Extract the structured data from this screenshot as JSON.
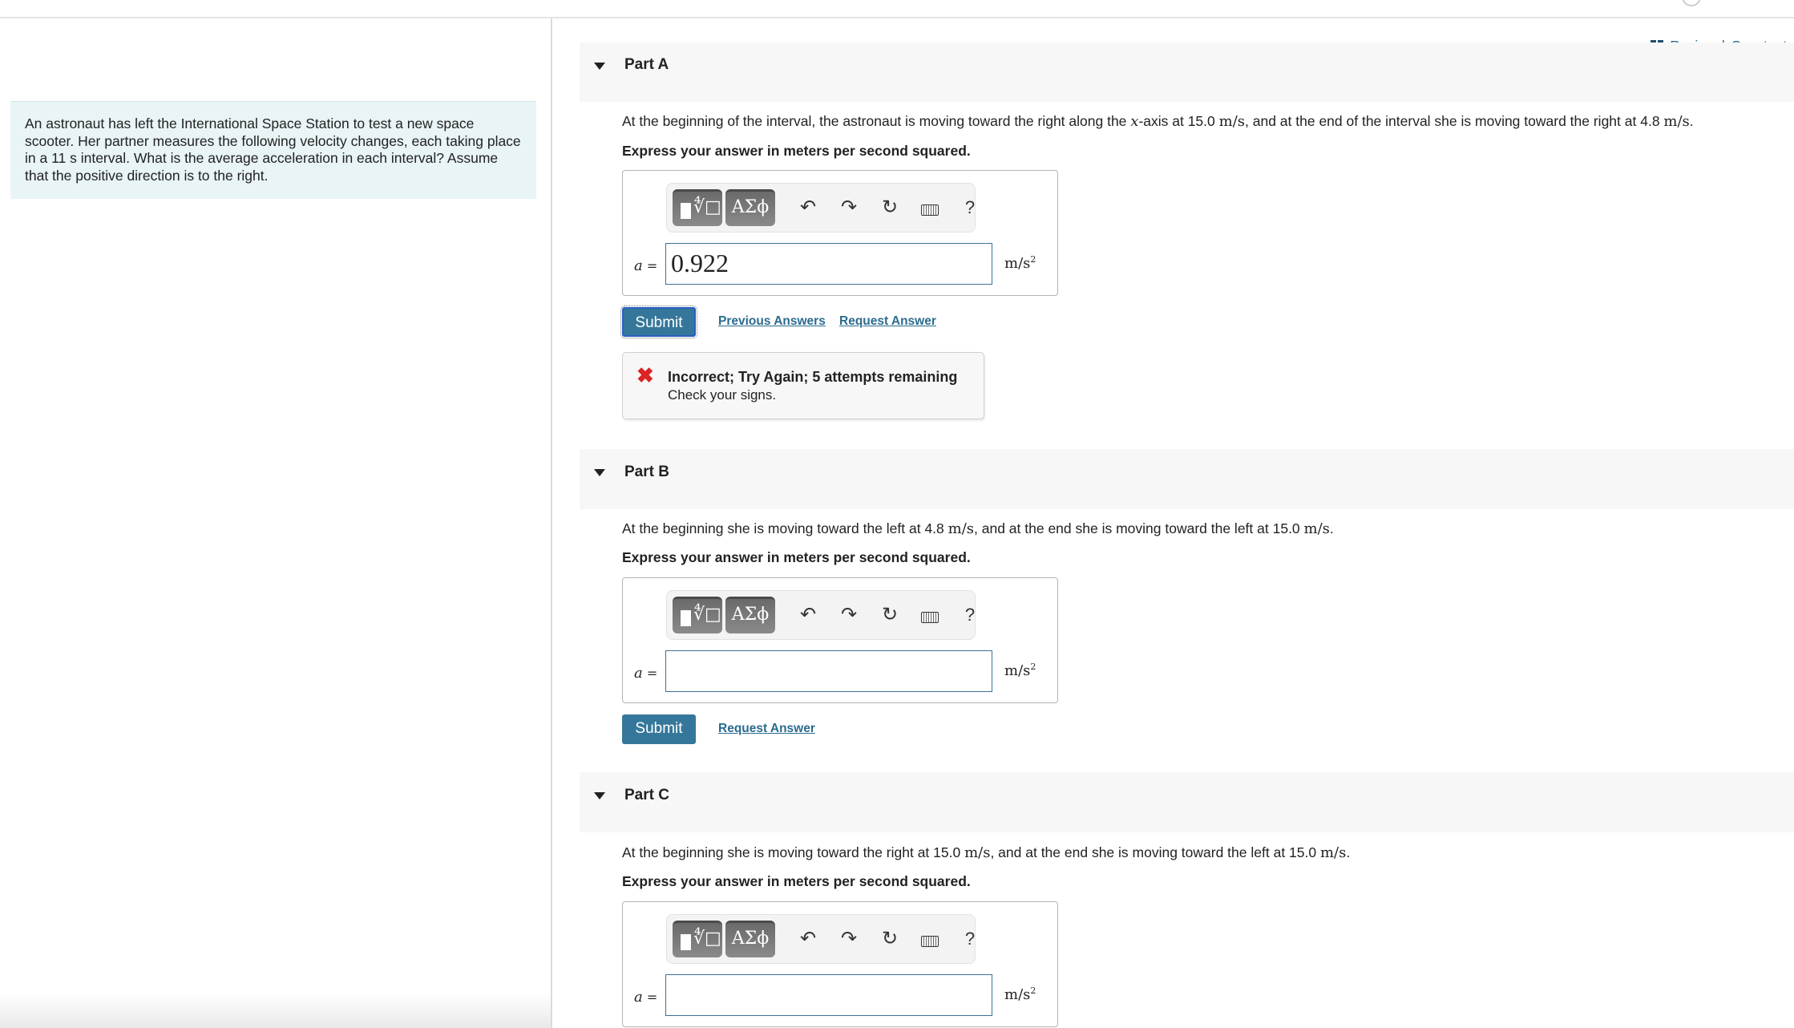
{
  "header": {
    "links": {
      "review": "Review",
      "separator": "|",
      "constants": "Constants"
    }
  },
  "intro": "An astronaut has left the International Space Station to test a new space scooter. Her partner measures the following velocity changes, each taking place in a 11 s interval. What is the average acceleration in each interval? Assume that the positive direction is to the right.",
  "toolbar": {
    "templates_icon": "templates-icon",
    "greek_label": "ΑΣϕ",
    "undo_icon": "undo-icon",
    "redo_icon": "redo-icon",
    "reset_icon": "reset-icon",
    "keyboard_icon": "keyboard-icon",
    "help_label": "?"
  },
  "parts": [
    {
      "title": "Part A",
      "q": [
        "At the beginning of the interval, the astronaut is moving toward the right along the ",
        "x",
        "-axis at 15.0 ",
        "m/s",
        ", and at the end of the interval she is moving toward the right at 4.8 ",
        "m/s",
        "."
      ],
      "express": "Express your answer in meters per second squared.",
      "var": "a",
      "eq": "=",
      "value": "0.922",
      "unit": "m/s",
      "unit_exp": "2",
      "submit": "Submit",
      "previous_answers": "Previous Answers",
      "request_answer": "Request Answer",
      "feedback": {
        "status": "incorrect",
        "title": "Incorrect; Try Again; 5 attempts remaining",
        "message": "Check your signs.",
        "color": "#dd2222"
      }
    },
    {
      "title": "Part B",
      "q": [
        "At the beginning she is moving toward the left at 4.8 ",
        "m/s",
        ", and at the end she is moving toward the left at 15.0 ",
        "m/s",
        "."
      ],
      "express": "Express your answer in meters per second squared.",
      "var": "a",
      "eq": "=",
      "value": "",
      "unit": "m/s",
      "unit_exp": "2",
      "submit": "Submit",
      "request_answer": "Request Answer"
    },
    {
      "title": "Part C",
      "q": [
        "At the beginning she is moving toward the right at 15.0 ",
        "m/s",
        ", and at the end she is moving toward the left at 15.0 ",
        "m/s",
        "."
      ],
      "express": "Express your answer in meters per second squared.",
      "var": "a",
      "eq": "=",
      "value": "",
      "unit": "m/s",
      "unit_exp": "2"
    }
  ],
  "colors": {
    "accent": "#35779a",
    "link": "#2a6b8f",
    "intro_bg": "#e8f4f6",
    "error": "#dd2222"
  }
}
